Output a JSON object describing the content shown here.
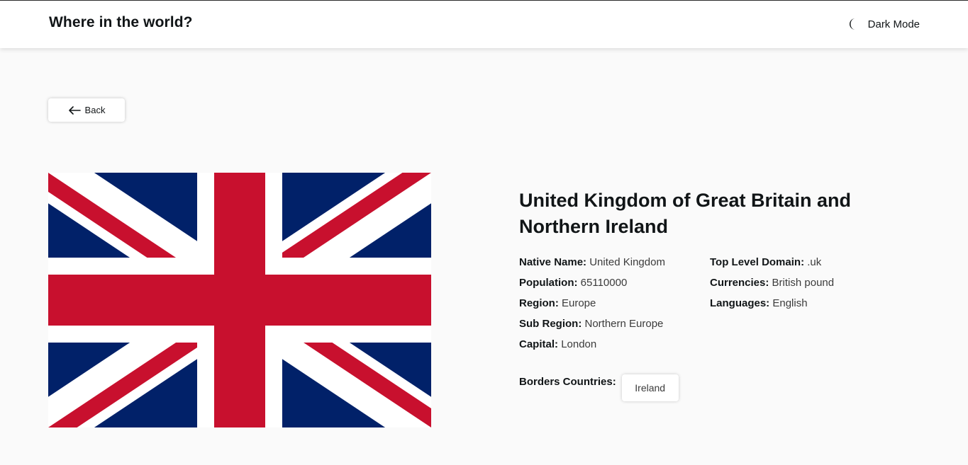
{
  "header": {
    "title": "Where in the world?",
    "dark_mode_label": "Dark Mode",
    "dark_mode_icon": "moon-icon"
  },
  "back_button": {
    "label": "Back",
    "icon": "arrow-left-icon"
  },
  "flag": {
    "icon": "union-jack-flag",
    "colors": {
      "blue": "#012169",
      "white": "#FFFFFF",
      "red": "#C8102E"
    }
  },
  "country": {
    "name": "United Kingdom of Great Britain and Northern Ireland",
    "left_details": [
      {
        "label": "Native Name:",
        "value": "United Kingdom"
      },
      {
        "label": "Population:",
        "value": "65110000"
      },
      {
        "label": "Region:",
        "value": "Europe"
      },
      {
        "label": "Sub Region:",
        "value": "Northern Europe"
      },
      {
        "label": "Capital:",
        "value": "London"
      }
    ],
    "right_details": [
      {
        "label": "Top Level Domain:",
        "value": ".uk"
      },
      {
        "label": "Currencies:",
        "value": "British pound"
      },
      {
        "label": "Languages:",
        "value": "English"
      }
    ],
    "borders_label": "Borders Countries:",
    "borders": [
      "Ireland"
    ]
  },
  "colors": {
    "background": "#fafafa",
    "surface": "#ffffff",
    "text": "#111517"
  }
}
